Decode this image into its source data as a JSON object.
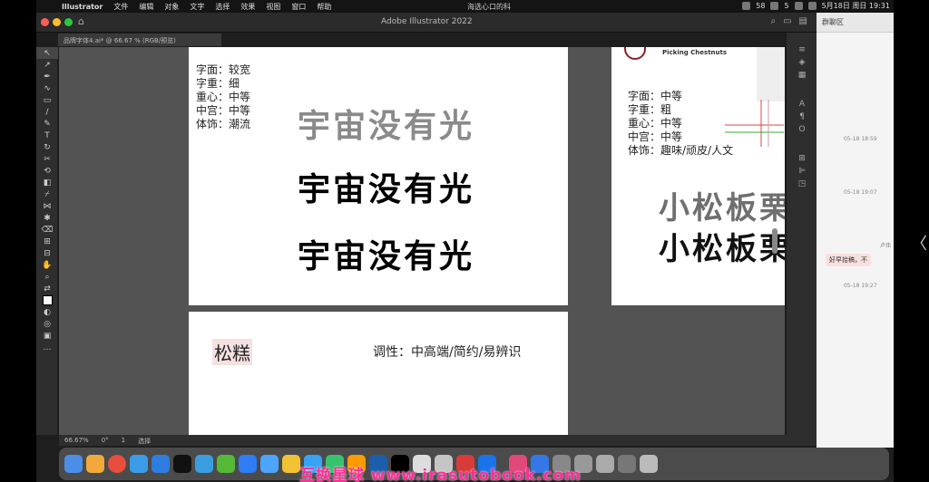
{
  "menubar": {
    "app": "Illustrator",
    "items": [
      "文件",
      "编辑",
      "对象",
      "文字",
      "选择",
      "效果",
      "视图",
      "窗口",
      "帮助"
    ],
    "center": "海选心口的科",
    "battery": "58",
    "count": "5",
    "clock": "5月18日 周日 19:31"
  },
  "window": {
    "title": "Adobe Illustrator 2022",
    "doc_tab": "品牌字体4.ai* @ 66.67 % (RGB/预览)"
  },
  "artboard1": {
    "specs": [
      "字面：较宽",
      "字重：细",
      "重心：中等",
      "中宫：中等",
      "体饰：潮流"
    ],
    "samples": [
      "宇宙没有光",
      "宇宙没有光",
      "宇宙没有光"
    ]
  },
  "artboard2": {
    "logo_text": "Picking Chestnuts",
    "specs": [
      "字面：中等",
      "字重：粗",
      "重心：中等",
      "中宫：中等",
      "体饰：趣味/顽皮/人文"
    ],
    "samples": [
      "小松板栗",
      "小松板栗"
    ]
  },
  "artboard3": {
    "name": "松糕",
    "tone": "调性：中高端/简约/易辨识"
  },
  "statusbar": {
    "zoom": "66.67%",
    "angle": "0°",
    "page": "1",
    "tool": "选择"
  },
  "chat": {
    "title": "群聊区",
    "times": [
      "05-18 18:59",
      "05-18 19:07",
      "05-18 19:27"
    ],
    "sender": "卢伟",
    "message": "好早拾稿，不"
  },
  "watermark": "互换星球 www.irasutobook.com",
  "colors": {
    "close": "#ff5f57",
    "minimize": "#febc2e",
    "maximize": "#28c840",
    "watermark": "#ff2d9a"
  }
}
